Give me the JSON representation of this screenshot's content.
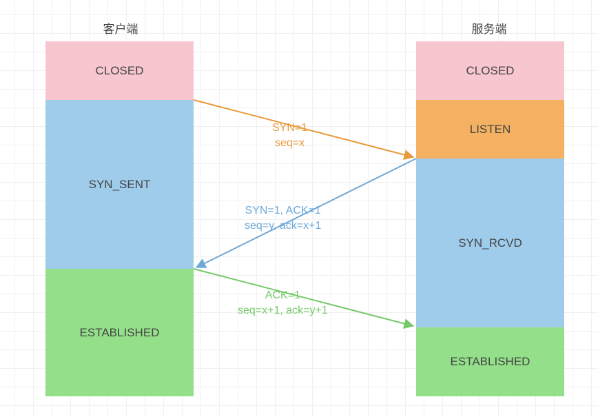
{
  "client_label": "客户端",
  "server_label": "服务端",
  "client_states": {
    "closed": "CLOSED",
    "syn_sent": "SYN_SENT",
    "established": "ESTABLISHED"
  },
  "server_states": {
    "closed": "CLOSED",
    "listen": "LISTEN",
    "syn_rcvd": "SYN_RCVD",
    "established": "ESTABLISHED"
  },
  "messages": {
    "syn": {
      "line1": "SYN=1",
      "line2": "seq=x"
    },
    "synack": {
      "line1": "SYN=1, ACK=1",
      "line2": "seq=y, ack=x+1"
    },
    "ack": {
      "line1": "ACK=1",
      "line2": "seq=x+1, ack=y+1"
    }
  },
  "chart_data": {
    "type": "sequence_diagram",
    "title": "TCP three-way handshake",
    "participants": [
      {
        "role": "client",
        "label": "客户端",
        "states": [
          "CLOSED",
          "SYN_SENT",
          "ESTABLISHED"
        ]
      },
      {
        "role": "server",
        "label": "服务端",
        "states": [
          "CLOSED",
          "LISTEN",
          "SYN_RCVD",
          "ESTABLISHED"
        ]
      }
    ],
    "messages": [
      {
        "from": "client",
        "to": "server",
        "from_state_after": "SYN_SENT",
        "to_state_after": "SYN_RCVD",
        "flags": "SYN=1",
        "seq": "x",
        "ack": null,
        "color": "#e89a3c"
      },
      {
        "from": "server",
        "to": "client",
        "from_state_after": "SYN_RCVD",
        "to_state_after": "ESTABLISHED",
        "flags": "SYN=1, ACK=1",
        "seq": "y",
        "ack": "x+1",
        "color": "#6fa8d6"
      },
      {
        "from": "client",
        "to": "server",
        "from_state_after": "ESTABLISHED",
        "to_state_after": "ESTABLISHED",
        "flags": "ACK=1",
        "seq": "x+1",
        "ack": "y+1",
        "color": "#75c96a"
      }
    ],
    "colors": {
      "CLOSED": "#f7c6cf",
      "LISTEN": "#f3b161",
      "SYN_SENT": "#9fcceb",
      "SYN_RCVD": "#9fcceb",
      "ESTABLISHED": "#94e08a"
    }
  }
}
